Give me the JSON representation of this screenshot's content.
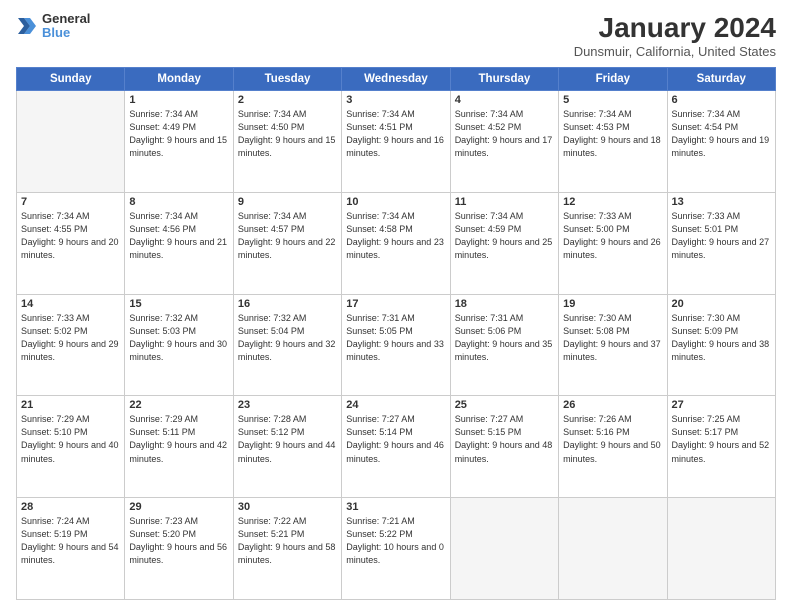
{
  "header": {
    "logo": {
      "line1": "General",
      "line2": "Blue"
    },
    "title": "January 2024",
    "location": "Dunsmuir, California, United States"
  },
  "calendar": {
    "weekdays": [
      "Sunday",
      "Monday",
      "Tuesday",
      "Wednesday",
      "Thursday",
      "Friday",
      "Saturday"
    ],
    "weeks": [
      [
        {
          "day": "",
          "empty": true
        },
        {
          "day": "1",
          "rise": "Sunrise: 7:34 AM",
          "set": "Sunset: 4:49 PM",
          "daylight": "Daylight: 9 hours and 15 minutes."
        },
        {
          "day": "2",
          "rise": "Sunrise: 7:34 AM",
          "set": "Sunset: 4:50 PM",
          "daylight": "Daylight: 9 hours and 15 minutes."
        },
        {
          "day": "3",
          "rise": "Sunrise: 7:34 AM",
          "set": "Sunset: 4:51 PM",
          "daylight": "Daylight: 9 hours and 16 minutes."
        },
        {
          "day": "4",
          "rise": "Sunrise: 7:34 AM",
          "set": "Sunset: 4:52 PM",
          "daylight": "Daylight: 9 hours and 17 minutes."
        },
        {
          "day": "5",
          "rise": "Sunrise: 7:34 AM",
          "set": "Sunset: 4:53 PM",
          "daylight": "Daylight: 9 hours and 18 minutes."
        },
        {
          "day": "6",
          "rise": "Sunrise: 7:34 AM",
          "set": "Sunset: 4:54 PM",
          "daylight": "Daylight: 9 hours and 19 minutes."
        }
      ],
      [
        {
          "day": "7",
          "rise": "Sunrise: 7:34 AM",
          "set": "Sunset: 4:55 PM",
          "daylight": "Daylight: 9 hours and 20 minutes."
        },
        {
          "day": "8",
          "rise": "Sunrise: 7:34 AM",
          "set": "Sunset: 4:56 PM",
          "daylight": "Daylight: 9 hours and 21 minutes."
        },
        {
          "day": "9",
          "rise": "Sunrise: 7:34 AM",
          "set": "Sunset: 4:57 PM",
          "daylight": "Daylight: 9 hours and 22 minutes."
        },
        {
          "day": "10",
          "rise": "Sunrise: 7:34 AM",
          "set": "Sunset: 4:58 PM",
          "daylight": "Daylight: 9 hours and 23 minutes."
        },
        {
          "day": "11",
          "rise": "Sunrise: 7:34 AM",
          "set": "Sunset: 4:59 PM",
          "daylight": "Daylight: 9 hours and 25 minutes."
        },
        {
          "day": "12",
          "rise": "Sunrise: 7:33 AM",
          "set": "Sunset: 5:00 PM",
          "daylight": "Daylight: 9 hours and 26 minutes."
        },
        {
          "day": "13",
          "rise": "Sunrise: 7:33 AM",
          "set": "Sunset: 5:01 PM",
          "daylight": "Daylight: 9 hours and 27 minutes."
        }
      ],
      [
        {
          "day": "14",
          "rise": "Sunrise: 7:33 AM",
          "set": "Sunset: 5:02 PM",
          "daylight": "Daylight: 9 hours and 29 minutes."
        },
        {
          "day": "15",
          "rise": "Sunrise: 7:32 AM",
          "set": "Sunset: 5:03 PM",
          "daylight": "Daylight: 9 hours and 30 minutes."
        },
        {
          "day": "16",
          "rise": "Sunrise: 7:32 AM",
          "set": "Sunset: 5:04 PM",
          "daylight": "Daylight: 9 hours and 32 minutes."
        },
        {
          "day": "17",
          "rise": "Sunrise: 7:31 AM",
          "set": "Sunset: 5:05 PM",
          "daylight": "Daylight: 9 hours and 33 minutes."
        },
        {
          "day": "18",
          "rise": "Sunrise: 7:31 AM",
          "set": "Sunset: 5:06 PM",
          "daylight": "Daylight: 9 hours and 35 minutes."
        },
        {
          "day": "19",
          "rise": "Sunrise: 7:30 AM",
          "set": "Sunset: 5:08 PM",
          "daylight": "Daylight: 9 hours and 37 minutes."
        },
        {
          "day": "20",
          "rise": "Sunrise: 7:30 AM",
          "set": "Sunset: 5:09 PM",
          "daylight": "Daylight: 9 hours and 38 minutes."
        }
      ],
      [
        {
          "day": "21",
          "rise": "Sunrise: 7:29 AM",
          "set": "Sunset: 5:10 PM",
          "daylight": "Daylight: 9 hours and 40 minutes."
        },
        {
          "day": "22",
          "rise": "Sunrise: 7:29 AM",
          "set": "Sunset: 5:11 PM",
          "daylight": "Daylight: 9 hours and 42 minutes."
        },
        {
          "day": "23",
          "rise": "Sunrise: 7:28 AM",
          "set": "Sunset: 5:12 PM",
          "daylight": "Daylight: 9 hours and 44 minutes."
        },
        {
          "day": "24",
          "rise": "Sunrise: 7:27 AM",
          "set": "Sunset: 5:14 PM",
          "daylight": "Daylight: 9 hours and 46 minutes."
        },
        {
          "day": "25",
          "rise": "Sunrise: 7:27 AM",
          "set": "Sunset: 5:15 PM",
          "daylight": "Daylight: 9 hours and 48 minutes."
        },
        {
          "day": "26",
          "rise": "Sunrise: 7:26 AM",
          "set": "Sunset: 5:16 PM",
          "daylight": "Daylight: 9 hours and 50 minutes."
        },
        {
          "day": "27",
          "rise": "Sunrise: 7:25 AM",
          "set": "Sunset: 5:17 PM",
          "daylight": "Daylight: 9 hours and 52 minutes."
        }
      ],
      [
        {
          "day": "28",
          "rise": "Sunrise: 7:24 AM",
          "set": "Sunset: 5:19 PM",
          "daylight": "Daylight: 9 hours and 54 minutes."
        },
        {
          "day": "29",
          "rise": "Sunrise: 7:23 AM",
          "set": "Sunset: 5:20 PM",
          "daylight": "Daylight: 9 hours and 56 minutes."
        },
        {
          "day": "30",
          "rise": "Sunrise: 7:22 AM",
          "set": "Sunset: 5:21 PM",
          "daylight": "Daylight: 9 hours and 58 minutes."
        },
        {
          "day": "31",
          "rise": "Sunrise: 7:21 AM",
          "set": "Sunset: 5:22 PM",
          "daylight": "Daylight: 10 hours and 0 minutes."
        },
        {
          "day": "",
          "empty": true
        },
        {
          "day": "",
          "empty": true
        },
        {
          "day": "",
          "empty": true
        }
      ]
    ]
  }
}
